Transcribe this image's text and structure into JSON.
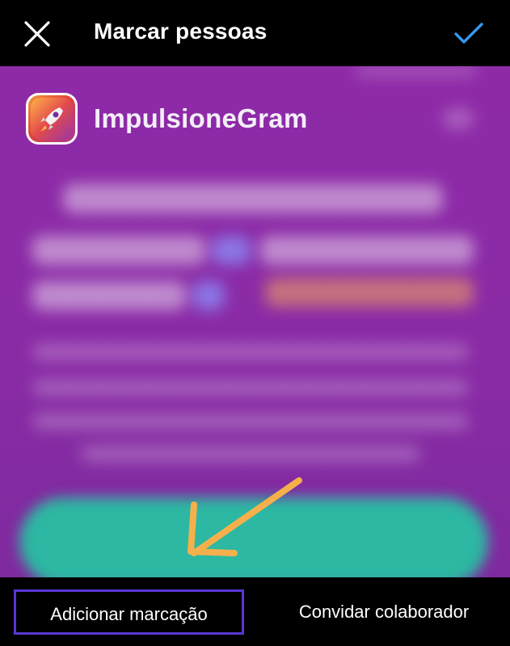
{
  "header": {
    "title": "Marcar pessoas",
    "close_icon": "close-icon",
    "done_icon": "checkmark-icon",
    "accent": "#3797f0"
  },
  "photo": {
    "brand_name": "ImpulsioneGram",
    "logo_icon": "rocket-icon",
    "background": "#8e2aa8",
    "button_color": "#2cb8a2",
    "arrow_color": "#f5b04c"
  },
  "bottom": {
    "add_tag_label": "Adicionar marcação",
    "invite_label": "Convidar colaborador",
    "highlight_color": "#5b35d4"
  }
}
